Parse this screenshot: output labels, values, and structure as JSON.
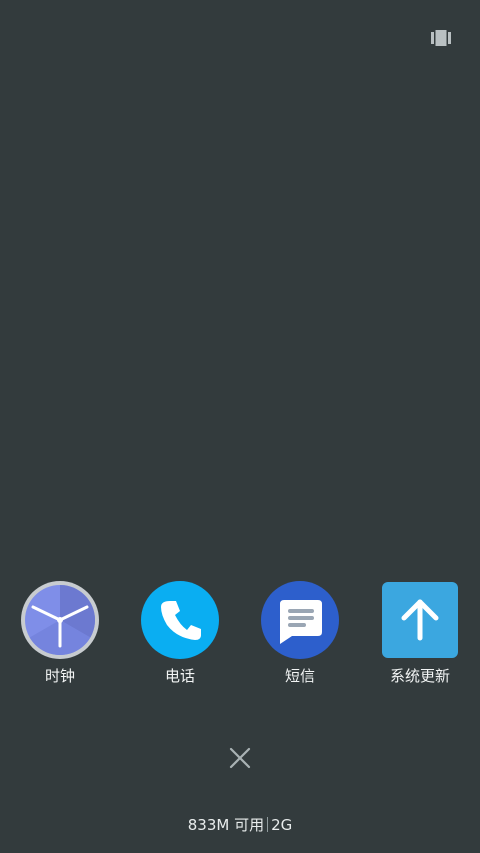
{
  "colors": {
    "background": "#333B3D",
    "clock_face": "#7F8EE8",
    "clock_rim": "#C8CCD0",
    "phone_bg": "#0AAEF2",
    "messages_bg": "#2D5FCC",
    "update_bg": "#3BA7E0"
  },
  "top_bar": {
    "view_toggle_icon": "multi-window-icon"
  },
  "recent_apps": [
    {
      "label": "时钟",
      "icon": "clock-icon"
    },
    {
      "label": "电话",
      "icon": "phone-icon"
    },
    {
      "label": "短信",
      "icon": "messages-icon"
    },
    {
      "label": "系统更新",
      "icon": "system-update-icon"
    }
  ],
  "close_all": {
    "icon": "close-icon"
  },
  "memory": {
    "available": "833M 可用",
    "total": "2G"
  }
}
